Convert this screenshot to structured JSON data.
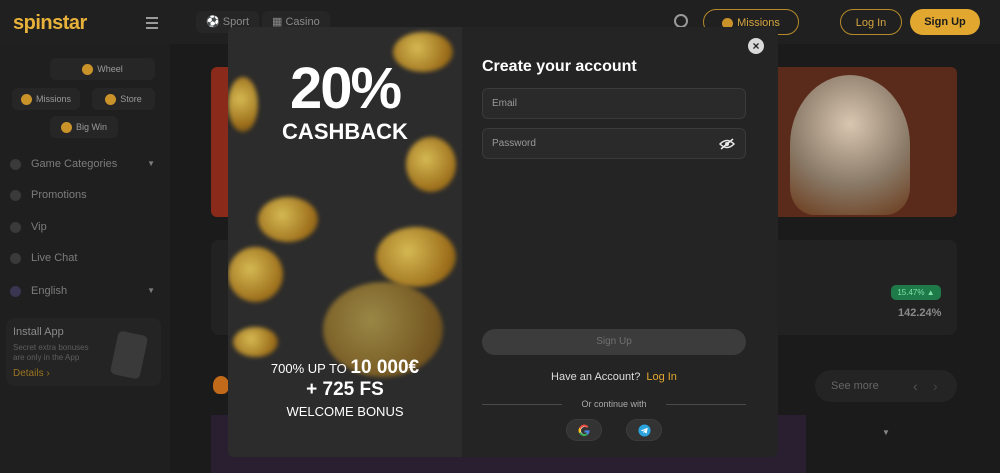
{
  "header": {
    "logo": "spinstar",
    "nav": [
      "Sport",
      "Casino"
    ],
    "missions_label": "Missions",
    "login_label": "Log In",
    "signup_label": "Sign Up"
  },
  "sidebar": {
    "wheel": "Wheel",
    "missions": "Missions",
    "store": "Store",
    "bigwin": "Big Win",
    "items": [
      "Game Categories",
      "Promotions",
      "Vip",
      "Live Chat",
      "English"
    ],
    "install": {
      "title": "Install App",
      "line1": "Secret extra bonuses",
      "line2": "are only in the App",
      "details": "Details"
    }
  },
  "main": {
    "badge": "15.47%",
    "percent": "142.24%",
    "see_more": "See more"
  },
  "modal": {
    "promo": {
      "percent": "20%",
      "cashback": "CASHBACK",
      "bonus_prefix": "700% UP TO",
      "bonus_amount": "10 000€",
      "bonus_fs": "+ 725 FS",
      "welcome": "WELCOME BONUS"
    },
    "title": "Create your account",
    "email_placeholder": "Email",
    "password_placeholder": "Password",
    "signup_label": "Sign Up",
    "have_account": "Have an Account?",
    "login_link": "Log In",
    "continue_with": "Or continue with",
    "close": "×"
  },
  "colors": {
    "accent": "#e1a72f",
    "bg": "#1b1b1b",
    "modal": "#242424"
  }
}
